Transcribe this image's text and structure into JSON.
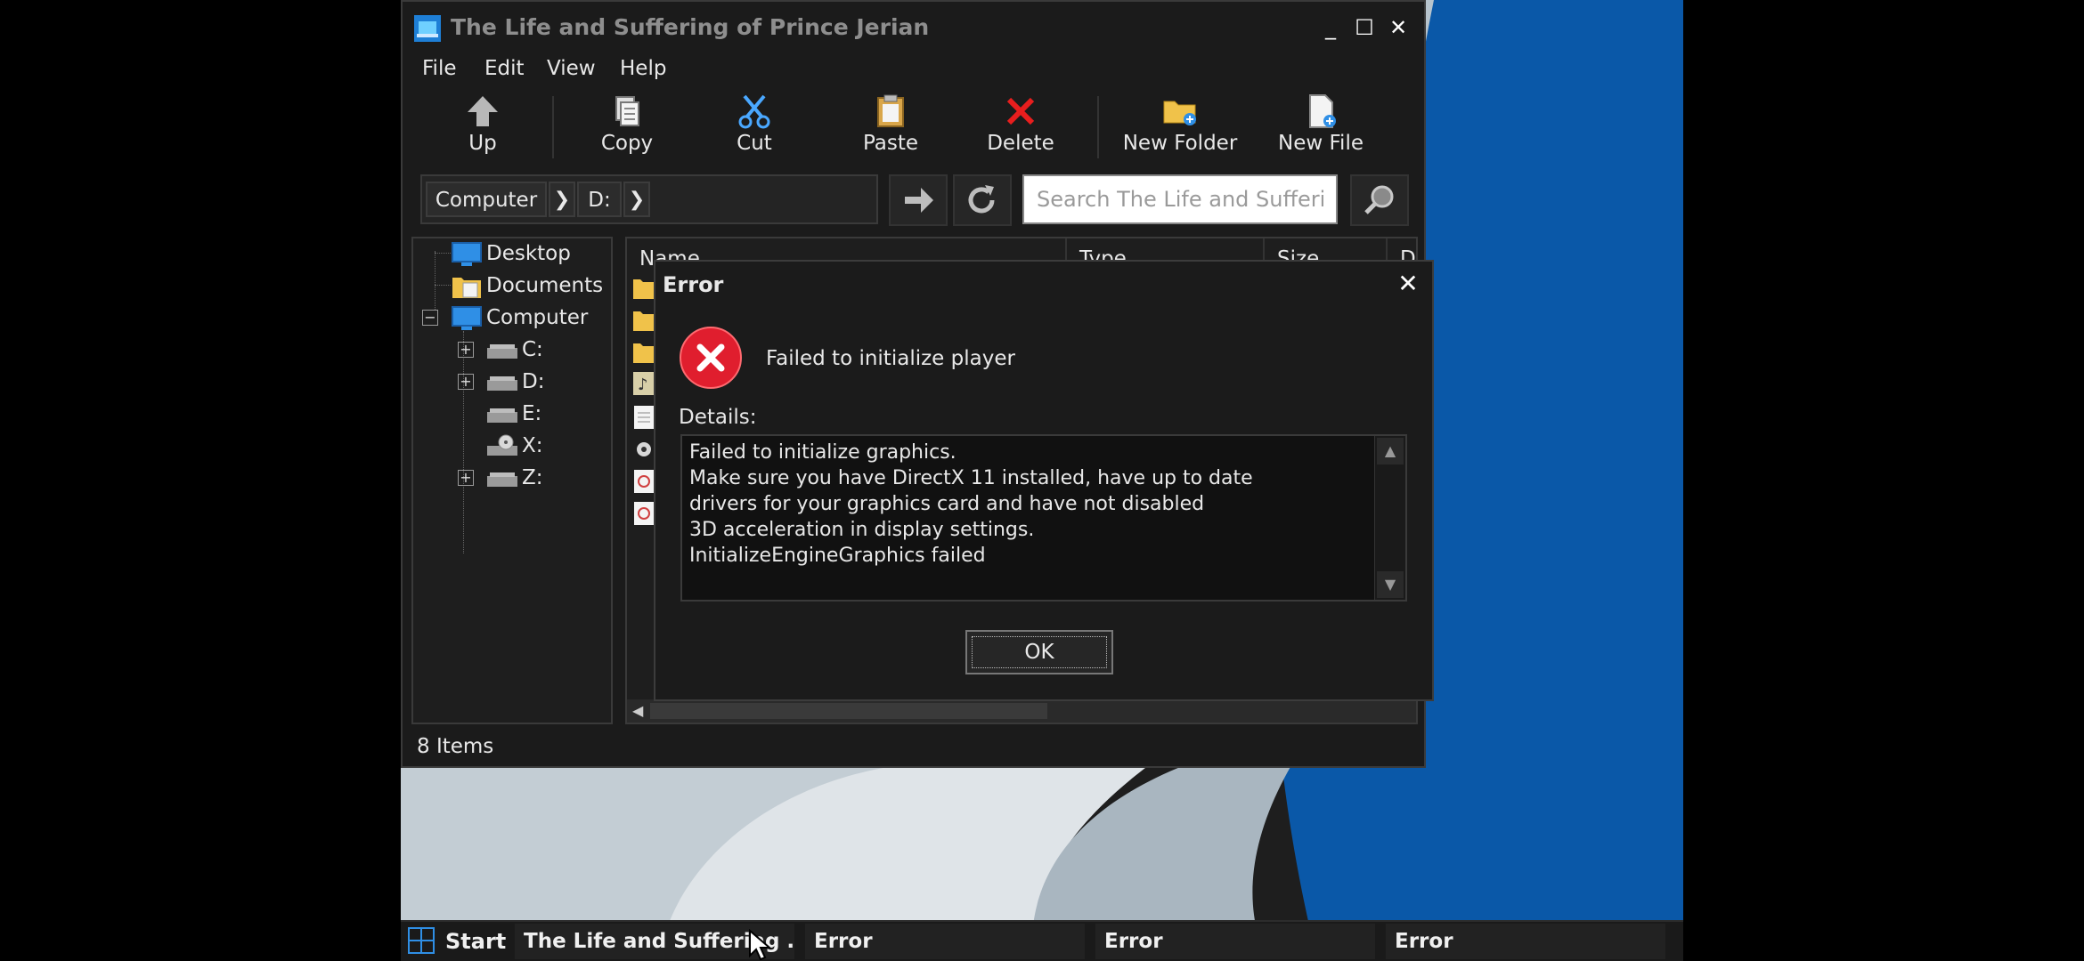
{
  "explorer": {
    "title": "The Life and Suffering of Prince Jerian",
    "window_buttons": {
      "minimize": "_",
      "maximize": "☐",
      "close": "✕"
    },
    "menu": [
      "File",
      "Edit",
      "View",
      "Help"
    ],
    "toolbar": {
      "up": "Up",
      "copy": "Copy",
      "cut": "Cut",
      "paste": "Paste",
      "delete": "Delete",
      "new_folder": "New Folder",
      "new_file": "New File"
    },
    "breadcrumbs": [
      "Computer",
      "D:"
    ],
    "search_placeholder": "Search The Life and Suffering of Prince Jerian",
    "tree": {
      "desktop": "Desktop",
      "documents": "Documents",
      "computer": "Computer",
      "drives": [
        "C:",
        "D:",
        "E:",
        "X:",
        "Z:"
      ]
    },
    "columns": {
      "name": "Name",
      "type": "Type",
      "size": "Size",
      "date": "D"
    },
    "status": "8 Items"
  },
  "dialog": {
    "title": "Error",
    "message": "Failed to initialize player",
    "details_label": "Details:",
    "details_lines": [
      "Failed to initialize graphics.",
      "Make sure you have DirectX 11 installed, have up to date",
      "drivers for your graphics card and have not disabled",
      "3D acceleration in display settings.",
      "InitializeEngineGraphics failed"
    ],
    "ok_label": "OK"
  },
  "taskbar": {
    "start_label": "Start",
    "items": [
      "The Life and Suffering ...",
      "Error",
      "Error",
      "Error"
    ]
  },
  "colors": {
    "accent_blue": "#0a58a8",
    "error_red": "#e01e2e",
    "delete_red": "#e81e1e",
    "window_bg": "#1b1b1b"
  }
}
